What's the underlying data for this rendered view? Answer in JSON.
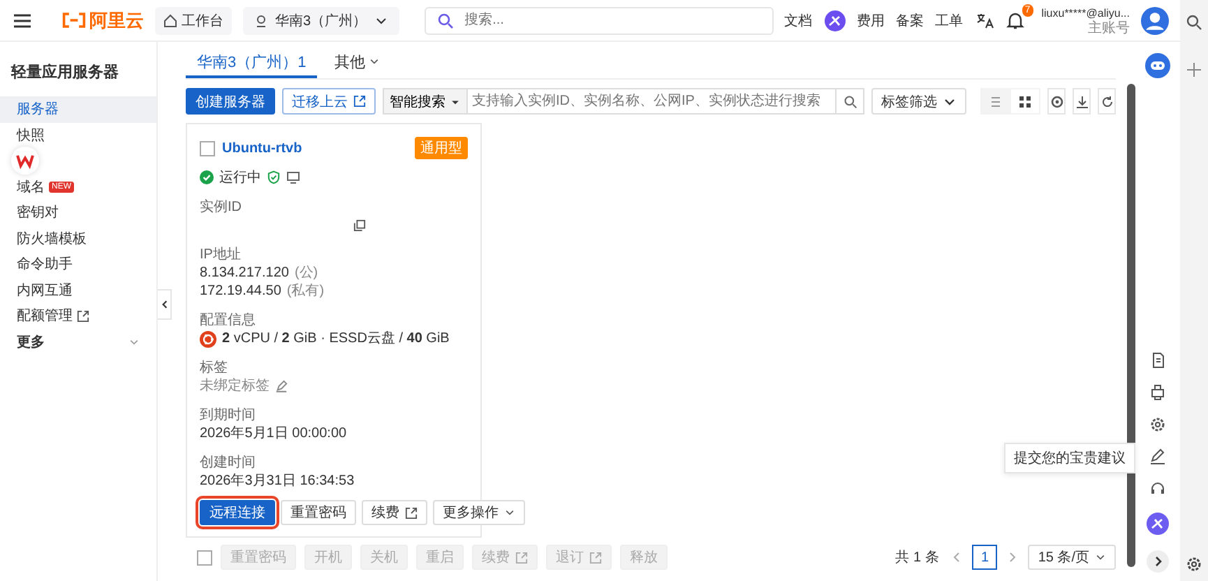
{
  "topbar": {
    "brand": "阿里云",
    "workbench": "工作台",
    "region": "华南3（广州）",
    "search_placeholder": "搜索...",
    "links": [
      "文档",
      "费用",
      "备案",
      "工单"
    ],
    "notification_badge": "7",
    "account": {
      "name": "liuxu*****@aliyu...",
      "role": "主账号"
    }
  },
  "sidebar": {
    "title": "轻量应用服务器",
    "items": [
      {
        "label": "服务器",
        "kind": "link",
        "selected": true
      },
      {
        "label": "快照",
        "kind": "link",
        "selected": false
      },
      {
        "label": "域名",
        "kind": "new",
        "badge": "NEW",
        "selected": false
      },
      {
        "label": "密钥对",
        "kind": "link",
        "selected": false
      },
      {
        "label": "防火墙模板",
        "kind": "link",
        "selected": false
      },
      {
        "label": "命令助手",
        "kind": "link",
        "selected": false
      },
      {
        "label": "内网互通",
        "kind": "link",
        "selected": false
      },
      {
        "label": "配额管理",
        "kind": "external",
        "selected": false
      },
      {
        "label": "更多",
        "kind": "group",
        "selected": false
      }
    ]
  },
  "tabs": [
    {
      "label": "华南3（广州）",
      "count": "1",
      "selected": true,
      "dropdown": false
    },
    {
      "label": "其他",
      "selected": false,
      "dropdown": true
    }
  ],
  "toolbar": {
    "create": "创建服务器",
    "migrate": "迁移上云",
    "search_mode": "智能搜索",
    "search_placeholder": "支持输入实例ID、实例名称、公网IP、实例状态进行搜索",
    "tag_filter": "标签筛选",
    "views": [
      {
        "kind": "list",
        "selected": false
      },
      {
        "kind": "grid",
        "selected": true
      }
    ]
  },
  "instances": [
    {
      "name": "Ubuntu-rtvb",
      "checked": false,
      "tag": "通用型",
      "status": "运行中",
      "id_label": "实例ID",
      "ip_label": "IP地址",
      "ips": [
        {
          "address": "8.134.217.120",
          "note": "(公)"
        },
        {
          "address": "172.19.44.50",
          "note": "(私有)"
        }
      ],
      "config_label": "配置信息",
      "config": "**2** vCPU / **2** GiB · ESSD云盘 / **40** GiB",
      "tag_label": "标签",
      "tags_value": "未绑定标签",
      "expire_label": "到期时间",
      "expire": "2026年5月1日 00:00:00",
      "created_label": "创建时间",
      "created": "2026年3月31日 16:34:53",
      "actions": [
        {
          "label": "远程连接",
          "primary": true,
          "highlighted": true,
          "external": false,
          "dropdown": false
        },
        {
          "label": "重置密码",
          "primary": false,
          "highlighted": false,
          "external": false,
          "dropdown": false
        },
        {
          "label": "续费",
          "primary": false,
          "highlighted": false,
          "external": true,
          "dropdown": false
        },
        {
          "label": "更多操作",
          "primary": false,
          "highlighted": false,
          "external": false,
          "dropdown": true
        }
      ]
    }
  ],
  "bulk": {
    "checked": false,
    "actions": [
      {
        "label": "重置密码",
        "disabled": true,
        "external": false
      },
      {
        "label": "开机",
        "disabled": true,
        "external": false
      },
      {
        "label": "关机",
        "disabled": true,
        "external": false
      },
      {
        "label": "重启",
        "disabled": true,
        "external": false
      },
      {
        "label": "续费",
        "disabled": true,
        "external": true
      },
      {
        "label": "退订",
        "disabled": true,
        "external": true
      },
      {
        "label": "释放",
        "disabled": true,
        "external": false
      }
    ]
  },
  "pagination": {
    "total": "共 1 条",
    "pages": [
      {
        "label": "1",
        "selected": true
      }
    ],
    "page_size": "15 条/页"
  },
  "tooltip": "提交您的宝贵建议"
}
